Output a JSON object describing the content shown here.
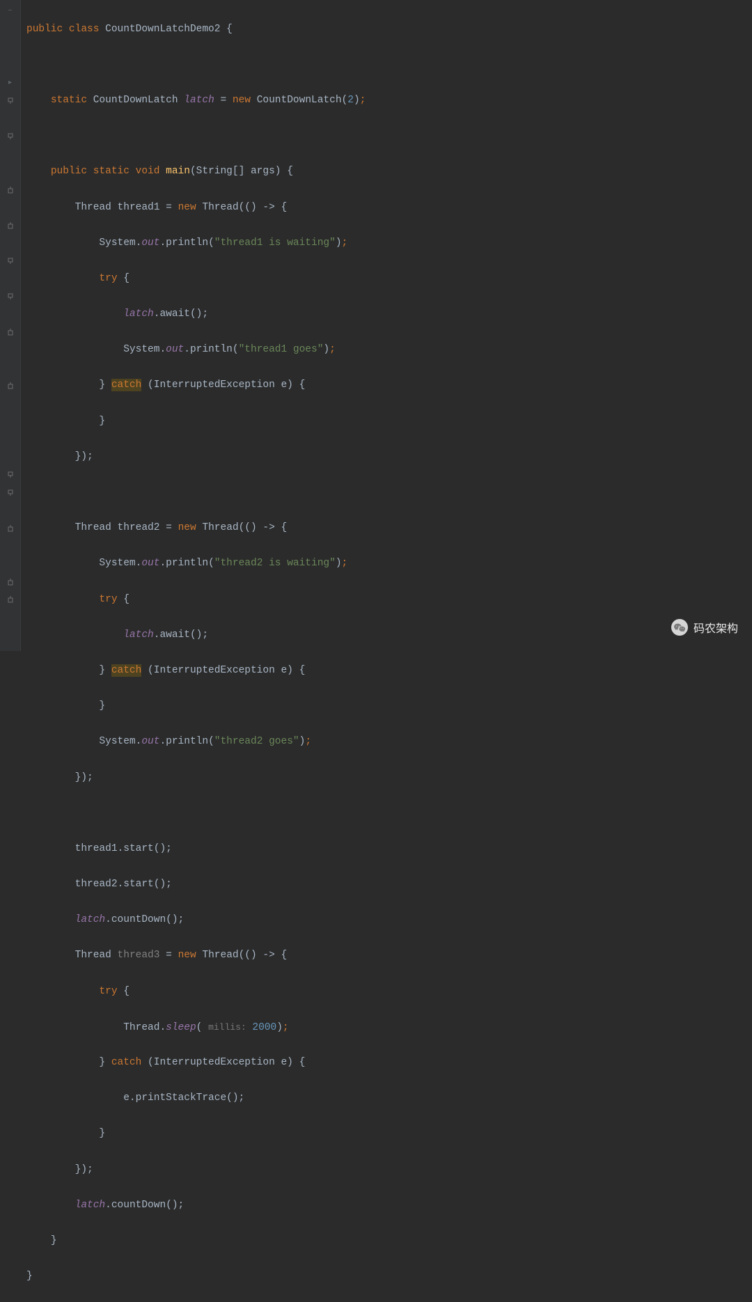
{
  "code": {
    "class_kw": "public class",
    "class_name": "CountDownLatchDemo2",
    "open_brace": "{",
    "close_brace": "}",
    "latch_decl_static": "static",
    "latch_type": "CountDownLatch",
    "latch_field": "latch",
    "eq": "=",
    "new_kw": "new",
    "latch_ctor": "CountDownLatch",
    "latch_arg": "2",
    "main_sig_kw": "public static void",
    "main_name": "main",
    "main_params": "(String[] args) {",
    "thread_type": "Thread",
    "t1_var": "thread1",
    "t2_var": "thread2",
    "t3_var": "thread3",
    "lambda_open": "Thread(() -> {",
    "lambda_close": "});",
    "sout_sys": "System",
    "sout_out": "out",
    "sout_println": "println",
    "t1_wait_msg": "\"thread1 is waiting\"",
    "t2_wait_msg": "\"thread2 is waiting\"",
    "t1_goes_msg": "\"thread1 goes\"",
    "t2_goes_msg": "\"thread2 goes\"",
    "try_kw": "try",
    "catch_kw": "catch",
    "catch_hl": "catch",
    "catch_sig": "(InterruptedException e) {",
    "await_call": ".await();",
    "countdown_call": ".countDown();",
    "start_call": ".start();",
    "sleep_name": "sleep",
    "sleep_hint": "millis:",
    "sleep_val": "2000",
    "printstack": "e.printStackTrace();",
    "brace_close": "}",
    "semi": ";",
    "paren_close": ")"
  },
  "watermark": {
    "text": "码农架构"
  }
}
